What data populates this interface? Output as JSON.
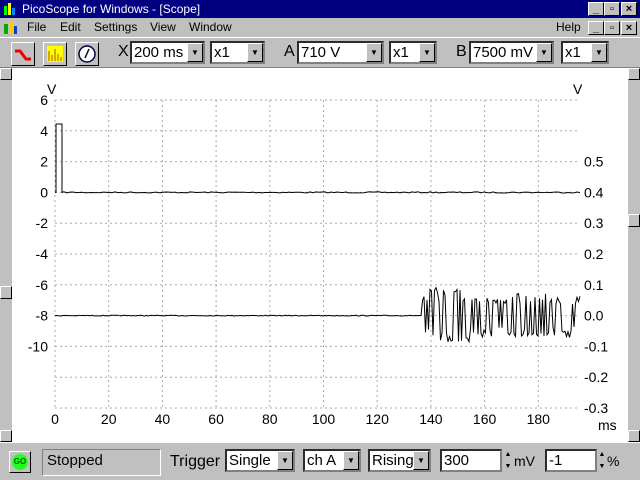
{
  "window": {
    "title": "PicoScope for Windows - [Scope]"
  },
  "menu": {
    "items": [
      "File",
      "Edit",
      "Settings",
      "View",
      "Window"
    ],
    "help": "Help"
  },
  "toolbar": {
    "x_label": "X",
    "timebase": "200 ms",
    "x_mult": "x1",
    "a_label": "A",
    "a_range": "710 V",
    "a_mult": "x1",
    "b_label": "B",
    "b_range": "7500 mV",
    "b_mult": "x1"
  },
  "scope": {
    "left_unit": "V",
    "right_unit": "V",
    "x_unit": "ms",
    "left_ticks": [
      "6",
      "4",
      "2",
      "0",
      "-2",
      "-4",
      "-6",
      "-8",
      "-10"
    ],
    "right_ticks": [
      "0.5",
      "0.4",
      "0.3",
      "0.2",
      "0.1",
      "0.0",
      "-0.1",
      "-0.2",
      "-0.3"
    ],
    "x_ticks": [
      "0",
      "20",
      "40",
      "60",
      "80",
      "100",
      "120",
      "140",
      "160",
      "180"
    ],
    "trace_a_color": "#000000",
    "trace_b_color": "#000000"
  },
  "status": {
    "go": "GO",
    "state": "Stopped",
    "trigger_label": "Trigger",
    "mode": "Single",
    "channel": "ch A",
    "edge": "Rising",
    "level": "300",
    "level_unit": "mV",
    "delay": "-1",
    "delay_unit": "%"
  }
}
